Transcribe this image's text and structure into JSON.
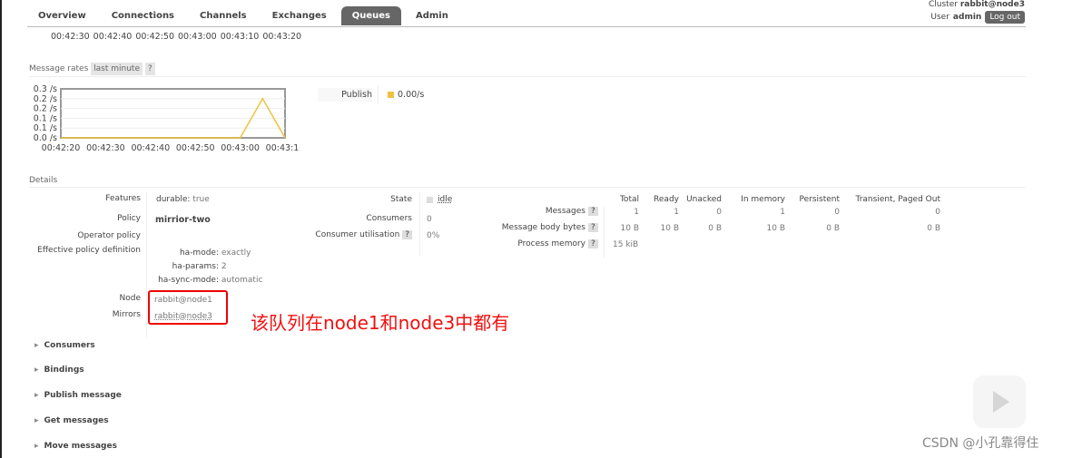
{
  "header": {
    "cluster_label": "Cluster",
    "cluster": "rabbit@node3",
    "user_label": "User",
    "user": "admin",
    "logout": "Log out"
  },
  "nav": {
    "tabs": [
      "Overview",
      "Connections",
      "Channels",
      "Exchanges",
      "Queues",
      "Admin"
    ],
    "active": "Queues"
  },
  "top_chart_ticks": [
    "0.0",
    "00:42:30",
    "00:42:40",
    "00:42:50",
    "00:43:00",
    "00:43:10",
    "00:43:20"
  ],
  "message_rates": {
    "label": "Message rates",
    "period": "last minute",
    "help": "?",
    "legend_label": "Publish",
    "legend_value": "0.00/s",
    "legend_color": "#edc240"
  },
  "chart_data": {
    "type": "line",
    "ylim": [
      0,
      0.25
    ],
    "y_tick_labels": [
      "0.0 /s",
      "0.1 /s",
      "0.1 /s",
      "0.2 /s",
      "0.2 /s",
      "0.3 /s"
    ],
    "x_tick_labels": [
      "00:42:20",
      "00:42:30",
      "00:42:40",
      "00:42:50",
      "00:43:00",
      "00:43:10"
    ],
    "series": [
      {
        "name": "Publish",
        "color": "#edc240",
        "x": [
          "00:42:20",
          "00:43:00",
          "00:43:05",
          "00:43:10"
        ],
        "y": [
          0,
          0,
          0.2,
          0
        ]
      }
    ],
    "grid": true
  },
  "details": {
    "label": "Details",
    "features_label": "Features",
    "durable_key": "durable:",
    "durable_val": "true",
    "policy_label": "Policy",
    "policy": "mirrior-two",
    "operator_policy_label": "Operator policy",
    "effective_label": "Effective policy definition",
    "effective": [
      {
        "k": "ha-mode:",
        "v": "exactly"
      },
      {
        "k": "ha-params:",
        "v": "2"
      },
      {
        "k": "ha-sync-mode:",
        "v": "automatic"
      }
    ],
    "node_label": "Node",
    "node": "rabbit@node1",
    "mirrors_label": "Mirrors",
    "mirrors": "rabbit@node3",
    "state_label": "State",
    "state": "idle",
    "consumers_label": "Consumers",
    "consumers": "0",
    "util_label": "Consumer utilisation",
    "util": "0%"
  },
  "stats": {
    "headers": [
      "Total",
      "Ready",
      "Unacked",
      "In memory",
      "Persistent",
      "Transient, Paged Out"
    ],
    "rows": [
      {
        "label": "Messages",
        "values": [
          "1",
          "1",
          "0",
          "1",
          "0",
          "0"
        ]
      },
      {
        "label": "Message body bytes",
        "values": [
          "10 B",
          "10 B",
          "0 B",
          "10 B",
          "0 B",
          "0 B"
        ]
      },
      {
        "label": "Process memory",
        "values": [
          "15 kiB"
        ]
      }
    ]
  },
  "annotation": "该队列在node1和node3中都有",
  "sections": [
    "Consumers",
    "Bindings",
    "Publish message",
    "Get messages",
    "Move messages"
  ],
  "watermark": "CSDN @小孔靠得住"
}
